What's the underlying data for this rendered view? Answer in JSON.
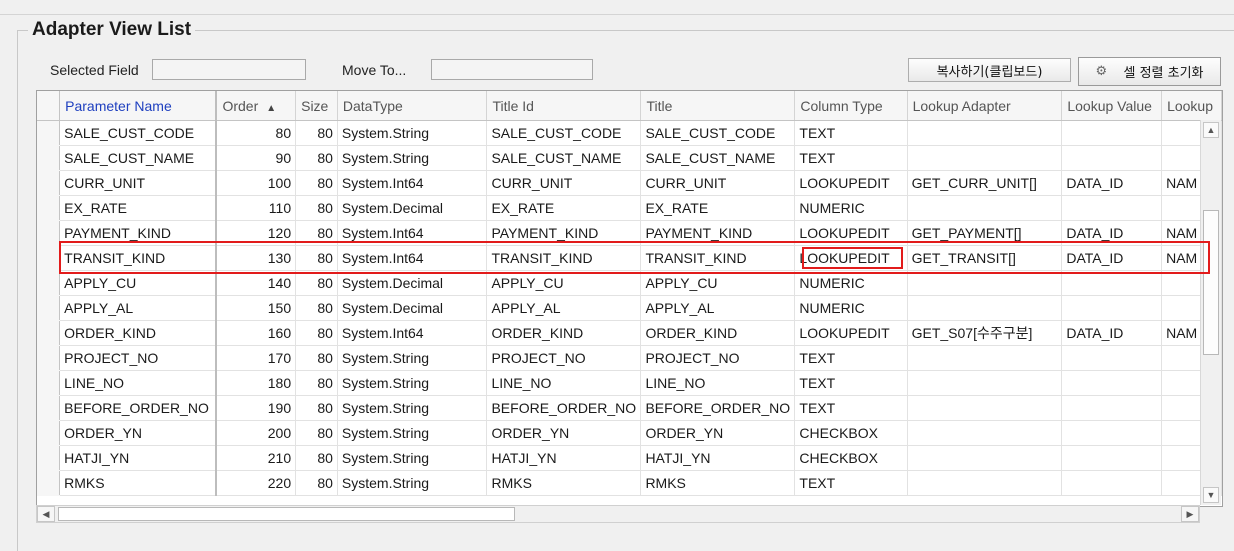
{
  "panel": {
    "title": "Adapter View List",
    "selected_field_label": "Selected Field",
    "move_to_label": "Move To...",
    "copy_button": "복사하기(클립보드)",
    "reset_sort_button": "셀 정렬 초기화",
    "selected_field_value": "",
    "move_to_value": ""
  },
  "grid": {
    "columns": [
      "Parameter Name",
      "Order",
      "Size",
      "DataType",
      "Title Id",
      "Title",
      "Column Type",
      "Lookup Adapter",
      "Lookup Value",
      "Lookup"
    ],
    "sort_column": "Order",
    "sort_direction": "ascending",
    "rows": [
      [
        "SALE_CUST_CODE",
        "80",
        "80",
        "System.String",
        "SALE_CUST_CODE",
        "SALE_CUST_CODE",
        "TEXT",
        "",
        "",
        ""
      ],
      [
        "SALE_CUST_NAME",
        "90",
        "80",
        "System.String",
        "SALE_CUST_NAME",
        "SALE_CUST_NAME",
        "TEXT",
        "",
        "",
        ""
      ],
      [
        "CURR_UNIT",
        "100",
        "80",
        "System.Int64",
        "CURR_UNIT",
        "CURR_UNIT",
        "LOOKUPEDIT",
        "GET_CURR_UNIT[]",
        "DATA_ID",
        "NAM"
      ],
      [
        "EX_RATE",
        "110",
        "80",
        "System.Decimal",
        "EX_RATE",
        "EX_RATE",
        "NUMERIC",
        "",
        "",
        ""
      ],
      [
        "PAYMENT_KIND",
        "120",
        "80",
        "System.Int64",
        "PAYMENT_KIND",
        "PAYMENT_KIND",
        "LOOKUPEDIT",
        "GET_PAYMENT[]",
        "DATA_ID",
        "NAM"
      ],
      [
        "TRANSIT_KIND",
        "130",
        "80",
        "System.Int64",
        "TRANSIT_KIND",
        "TRANSIT_KIND",
        "LOOKUPEDIT",
        "GET_TRANSIT[]",
        "DATA_ID",
        "NAM"
      ],
      [
        "APPLY_CU",
        "140",
        "80",
        "System.Decimal",
        "APPLY_CU",
        "APPLY_CU",
        "NUMERIC",
        "",
        "",
        ""
      ],
      [
        "APPLY_AL",
        "150",
        "80",
        "System.Decimal",
        "APPLY_AL",
        "APPLY_AL",
        "NUMERIC",
        "",
        "",
        ""
      ],
      [
        "ORDER_KIND",
        "160",
        "80",
        "System.Int64",
        "ORDER_KIND",
        "ORDER_KIND",
        "LOOKUPEDIT",
        "GET_S07[수주구분]",
        "DATA_ID",
        "NAM"
      ],
      [
        "PROJECT_NO",
        "170",
        "80",
        "System.String",
        "PROJECT_NO",
        "PROJECT_NO",
        "TEXT",
        "",
        "",
        ""
      ],
      [
        "LINE_NO",
        "180",
        "80",
        "System.String",
        "LINE_NO",
        "LINE_NO",
        "TEXT",
        "",
        "",
        ""
      ],
      [
        "BEFORE_ORDER_NO",
        "190",
        "80",
        "System.String",
        "BEFORE_ORDER_NO",
        "BEFORE_ORDER_NO",
        "TEXT",
        "",
        "",
        ""
      ],
      [
        "ORDER_YN",
        "200",
        "80",
        "System.String",
        "ORDER_YN",
        "ORDER_YN",
        "CHECKBOX",
        "",
        "",
        ""
      ],
      [
        "HATJI_YN",
        "210",
        "80",
        "System.String",
        "HATJI_YN",
        "HATJI_YN",
        "CHECKBOX",
        "",
        "",
        ""
      ],
      [
        "RMKS",
        "220",
        "80",
        "System.String",
        "RMKS",
        "RMKS",
        "TEXT",
        "",
        "",
        ""
      ]
    ],
    "highlighted_row": "TRANSIT_KIND",
    "highlighted_cell": "LOOKUPEDIT"
  },
  "colors": {
    "highlight": "#e21b1b",
    "header_link": "#1e3fbf"
  }
}
